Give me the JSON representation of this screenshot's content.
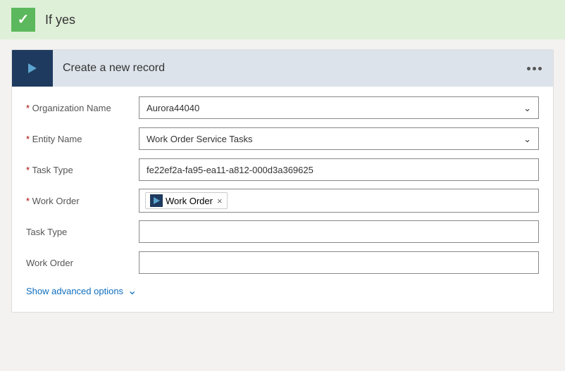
{
  "header": {
    "label": "If yes",
    "check_icon": "✓"
  },
  "card": {
    "title": "Create a new record",
    "more_icon": "...",
    "fields": [
      {
        "label": "Organization Name",
        "required": true,
        "type": "dropdown",
        "value": "Aurora44040"
      },
      {
        "label": "Entity Name",
        "required": true,
        "type": "dropdown",
        "value": "Work Order Service Tasks"
      },
      {
        "label": "Task Type",
        "required": true,
        "type": "text",
        "value": "fe22ef2a-fa95-ea11-a812-000d3a369625"
      },
      {
        "label": "Work Order",
        "required": true,
        "type": "tag",
        "tag_label": "Work Order"
      },
      {
        "label": "Task Type",
        "required": false,
        "type": "empty",
        "value": ""
      },
      {
        "label": "Work Order",
        "required": false,
        "type": "empty",
        "value": ""
      }
    ],
    "advanced_label": "Show advanced options"
  }
}
